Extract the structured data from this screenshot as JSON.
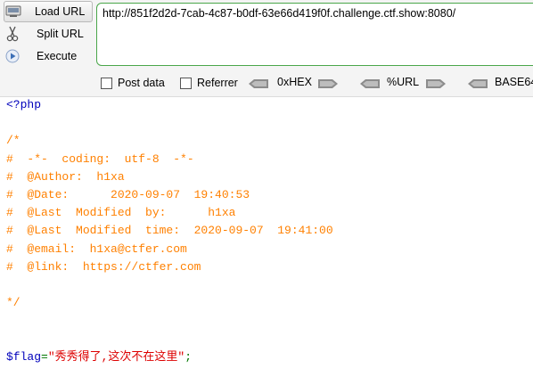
{
  "toolbar": {
    "load_label": "Load URL",
    "split_label": "Split URL",
    "execute_label": "Execute",
    "url_value": "http://851f2d2d-7cab-4c87-b0df-63e66d419f0f.challenge.ctf.show:8080/",
    "post_label": "Post data",
    "referrer_label": "Referrer",
    "hex_label": "0xHEX",
    "url_enc_label": "%URL",
    "base64_label": "BASE64"
  },
  "code": {
    "open_tag": "<?php",
    "comment_open": "/*",
    "c1": "#  -*-  coding:  utf-8  -*-",
    "c2": "#  @Author:  h1xa",
    "c3": "#  @Date:      2020-09-07  19:40:53",
    "c4": "#  @Last  Modified  by:      h1xa",
    "c5": "#  @Last  Modified  time:  2020-09-07  19:41:00",
    "c6": "#  @email:  h1xa@ctfer.com",
    "c7": "#  @link:  https://ctfer.com",
    "comment_close": "*/",
    "var_name": "$flag",
    "assign_op": "=",
    "string_value": "\"秀秀得了,这次不在这里\"",
    "semicolon": ";"
  },
  "colors": {
    "php_tag": "#0000bb",
    "comment": "#ff8000",
    "string": "#dd0000",
    "operator": "#007700",
    "url_border": "#4aa64a"
  }
}
